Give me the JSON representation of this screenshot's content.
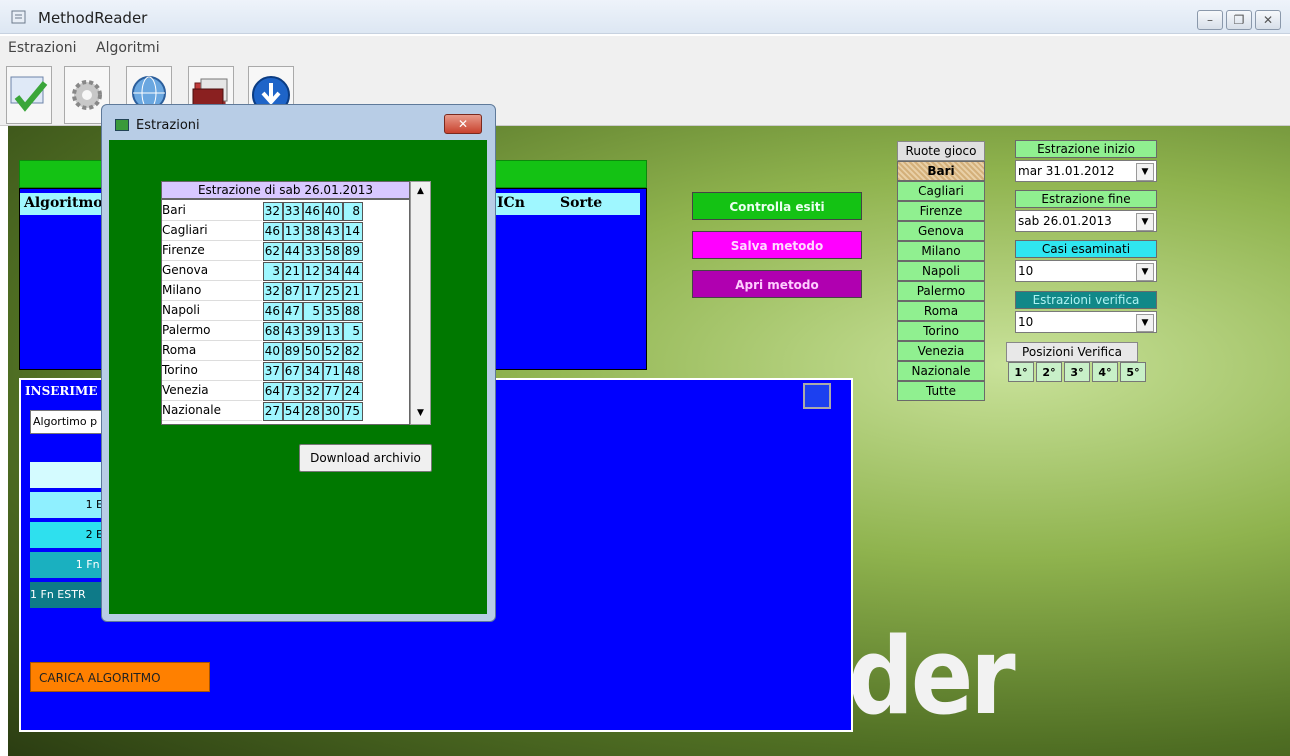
{
  "window": {
    "title": "MethodReader"
  },
  "menu": [
    "Estrazioni",
    "Algoritmi"
  ],
  "results": {
    "headers": [
      "Algoritmo",
      "ICn",
      "Sorte"
    ]
  },
  "insert_panel": {
    "title": "INSERIME",
    "select_value": "Algortimo p",
    "rows": [
      "1 ES",
      "2 ES",
      "1 Fn E",
      "1 Fn ESTR"
    ],
    "load_button": "CARICA ALGORITMO"
  },
  "actions": {
    "check": "Controlla esiti",
    "save": "Salva metodo",
    "open": "Apri metodo"
  },
  "ruote": {
    "title": "Ruote gioco",
    "items": [
      "Bari",
      "Cagliari",
      "Firenze",
      "Genova",
      "Milano",
      "Napoli",
      "Palermo",
      "Roma",
      "Torino",
      "Venezia",
      "Nazionale",
      "Tutte"
    ],
    "selected": "Bari"
  },
  "controls": {
    "start_label": "Estrazione inizio",
    "start_value": "mar 31.01.2012",
    "end_label": "Estrazione fine",
    "end_value": "sab 26.01.2013",
    "cases_label": "Casi esaminati",
    "cases_value": "10",
    "verify_label": "Estrazioni verifica",
    "verify_value": "10",
    "positions_label": "Posizioni Verifica",
    "positions": [
      "1°",
      "2°",
      "3°",
      "4°",
      "5°"
    ]
  },
  "brand_text": "der",
  "dialog": {
    "title": "Estrazioni",
    "grid_title": "Estrazione di  sab 26.01.2013",
    "rows": [
      {
        "city": "Bari",
        "nums": [
          "32",
          "33",
          "46",
          "40",
          "8"
        ]
      },
      {
        "city": "Cagliari",
        "nums": [
          "46",
          "13",
          "38",
          "43",
          "14"
        ]
      },
      {
        "city": "Firenze",
        "nums": [
          "62",
          "44",
          "33",
          "58",
          "89"
        ]
      },
      {
        "city": "Genova",
        "nums": [
          "3",
          "21",
          "12",
          "34",
          "44"
        ]
      },
      {
        "city": "Milano",
        "nums": [
          "32",
          "87",
          "17",
          "25",
          "21"
        ]
      },
      {
        "city": "Napoli",
        "nums": [
          "46",
          "47",
          "5",
          "35",
          "88"
        ]
      },
      {
        "city": "Palermo",
        "nums": [
          "68",
          "43",
          "39",
          "13",
          "5"
        ]
      },
      {
        "city": "Roma",
        "nums": [
          "40",
          "89",
          "50",
          "52",
          "82"
        ]
      },
      {
        "city": "Torino",
        "nums": [
          "37",
          "67",
          "34",
          "71",
          "48"
        ]
      },
      {
        "city": "Venezia",
        "nums": [
          "64",
          "73",
          "32",
          "77",
          "24"
        ]
      },
      {
        "city": "Nazionale",
        "nums": [
          "27",
          "54",
          "28",
          "30",
          "75"
        ]
      }
    ],
    "download_button": "Download archivio"
  },
  "colors": {
    "results_blue": "#0000ff",
    "dialog_green": "#007800",
    "check_btn": "#14c214",
    "save_btn": "#ff00ff",
    "open_btn": "#b000b0",
    "load_btn": "#ff8000"
  }
}
